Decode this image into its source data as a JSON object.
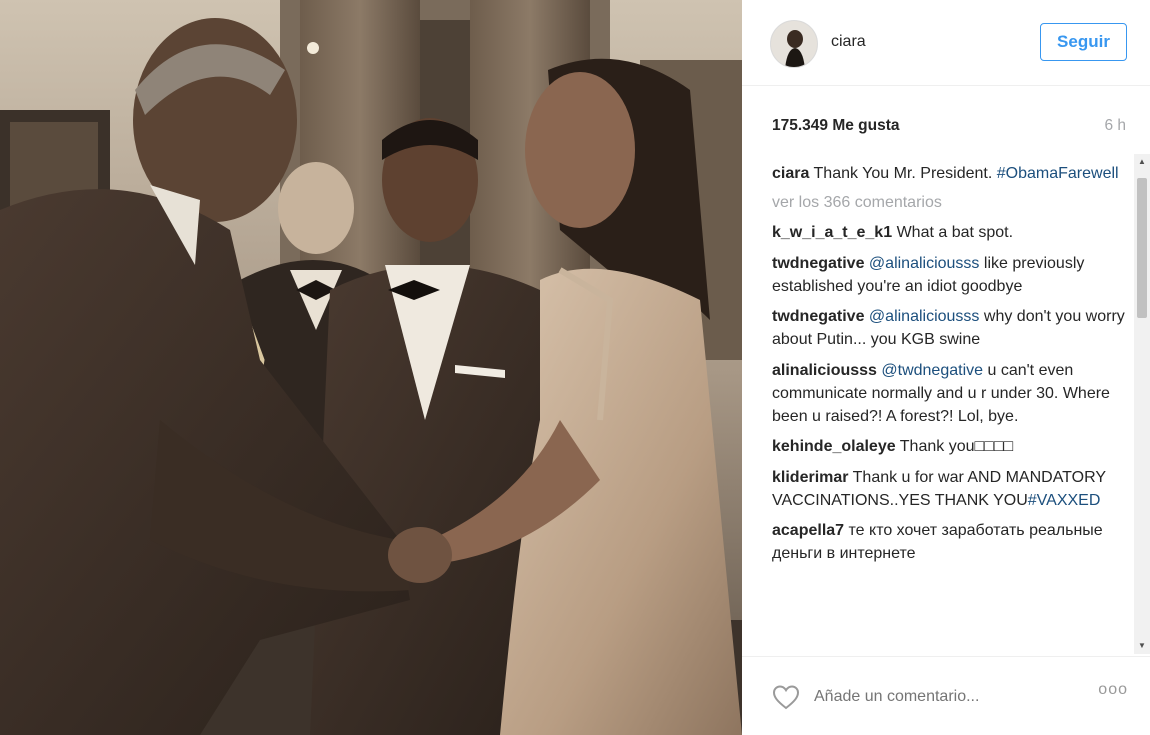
{
  "header": {
    "username": "ciara",
    "follow_label": "Seguir"
  },
  "stats": {
    "likes": "175.349 Me gusta",
    "time": "6 h"
  },
  "caption": {
    "user": "ciara",
    "text": "Thank You Mr. President.",
    "hashtag": "#ObamaFarewell"
  },
  "view_all": "ver los 366 comentarios",
  "comments": [
    {
      "user": "k_w_i_a_t_e_k1",
      "mention": "",
      "text": "What a bat spot."
    },
    {
      "user": "twdnegative",
      "mention": "@alinaliciousss",
      "text": "like previously established you're an idiot goodbye"
    },
    {
      "user": "twdnegative",
      "mention": "@alinaliciousss",
      "text": "why don't you worry about Putin... you KGB swine"
    },
    {
      "user": "alinaliciousss",
      "mention": "@twdnegative",
      "text": "u can't even communicate normally and u r under 30. Where been u raised?! A forest?! Lol, bye."
    },
    {
      "user": "kehinde_olaleye",
      "mention": "",
      "text": "Thank you□□□□"
    },
    {
      "user": "kliderimar",
      "mention": "",
      "text": "Thank u for war AND MANDATORY VACCINATIONS..YES THANK YOU",
      "hashtag": "#VAXXED"
    },
    {
      "user": "acapella7",
      "mention": "",
      "text": "те кто хочет заработать реальные деньги в интернете"
    }
  ],
  "footer": {
    "add_comment_placeholder": "Añade un comentario...",
    "more": "ooo"
  },
  "icons": {
    "like": "heart-outline-icon",
    "more": "ellipsis-icon"
  },
  "colors": {
    "accent": "#3897f0",
    "link": "#1c4f7d",
    "muted": "#a5a7aa"
  }
}
